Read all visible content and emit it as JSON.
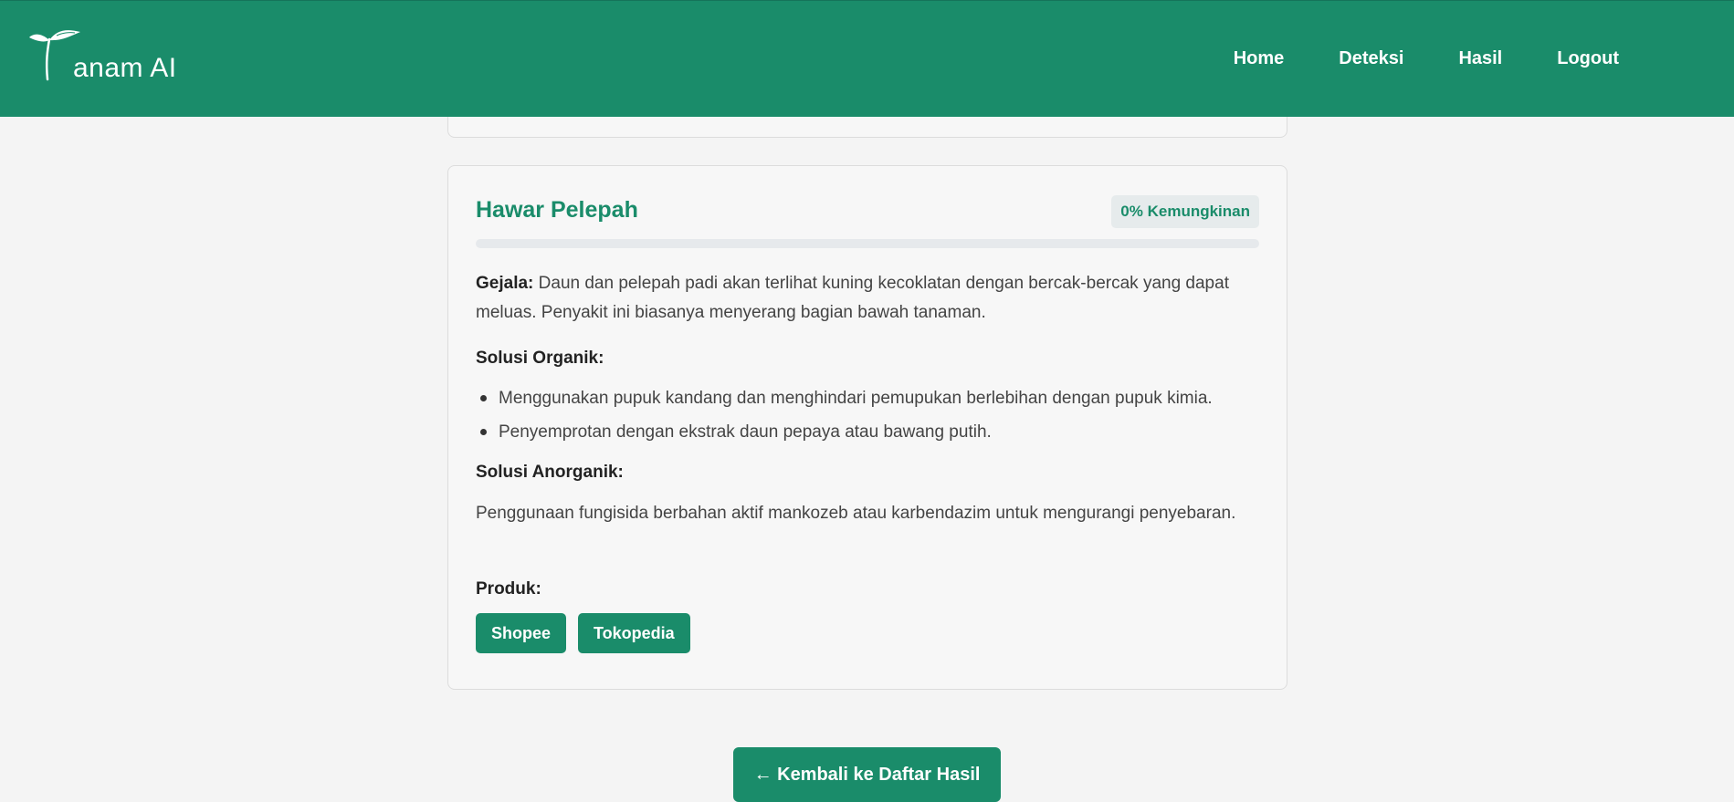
{
  "brand": {
    "name": "anam AI",
    "logo_icon": "sprout-icon"
  },
  "nav": {
    "items": [
      {
        "label": "Home"
      },
      {
        "label": "Deteksi"
      },
      {
        "label": "Hasil"
      },
      {
        "label": "Logout"
      }
    ]
  },
  "disease": {
    "title": "Hawar Pelepah",
    "probability_label": "0% Kemungkinan",
    "probability_value": 0,
    "symptom_label": "Gejala:",
    "symptom_text": " Daun dan pelepah padi akan terlihat kuning kecoklatan dengan bercak-bercak yang dapat meluas. Penyakit ini biasanya menyerang bagian bawah tanaman.",
    "organic_title": "Solusi Organik:",
    "organic_items": [
      "Menggunakan pupuk kandang dan menghindari pemupukan berlebihan dengan pupuk kimia.",
      "Penyemprotan dengan ekstrak daun pepaya atau bawang putih."
    ],
    "inorganic_title": "Solusi Anorganik:",
    "inorganic_text": "Penggunaan fungisida berbahan aktif mankozeb atau karbendazim untuk mengurangi penyebaran.",
    "product_title": "Produk:",
    "products": [
      {
        "label": "Shopee"
      },
      {
        "label": "Tokopedia"
      }
    ]
  },
  "back_button": "← Kembali ke Daftar Hasil",
  "colors": {
    "primary": "#1a8c6a",
    "background": "#f4f4f4",
    "card": "#f7f7f7",
    "badge_bg": "#e6ebec"
  }
}
